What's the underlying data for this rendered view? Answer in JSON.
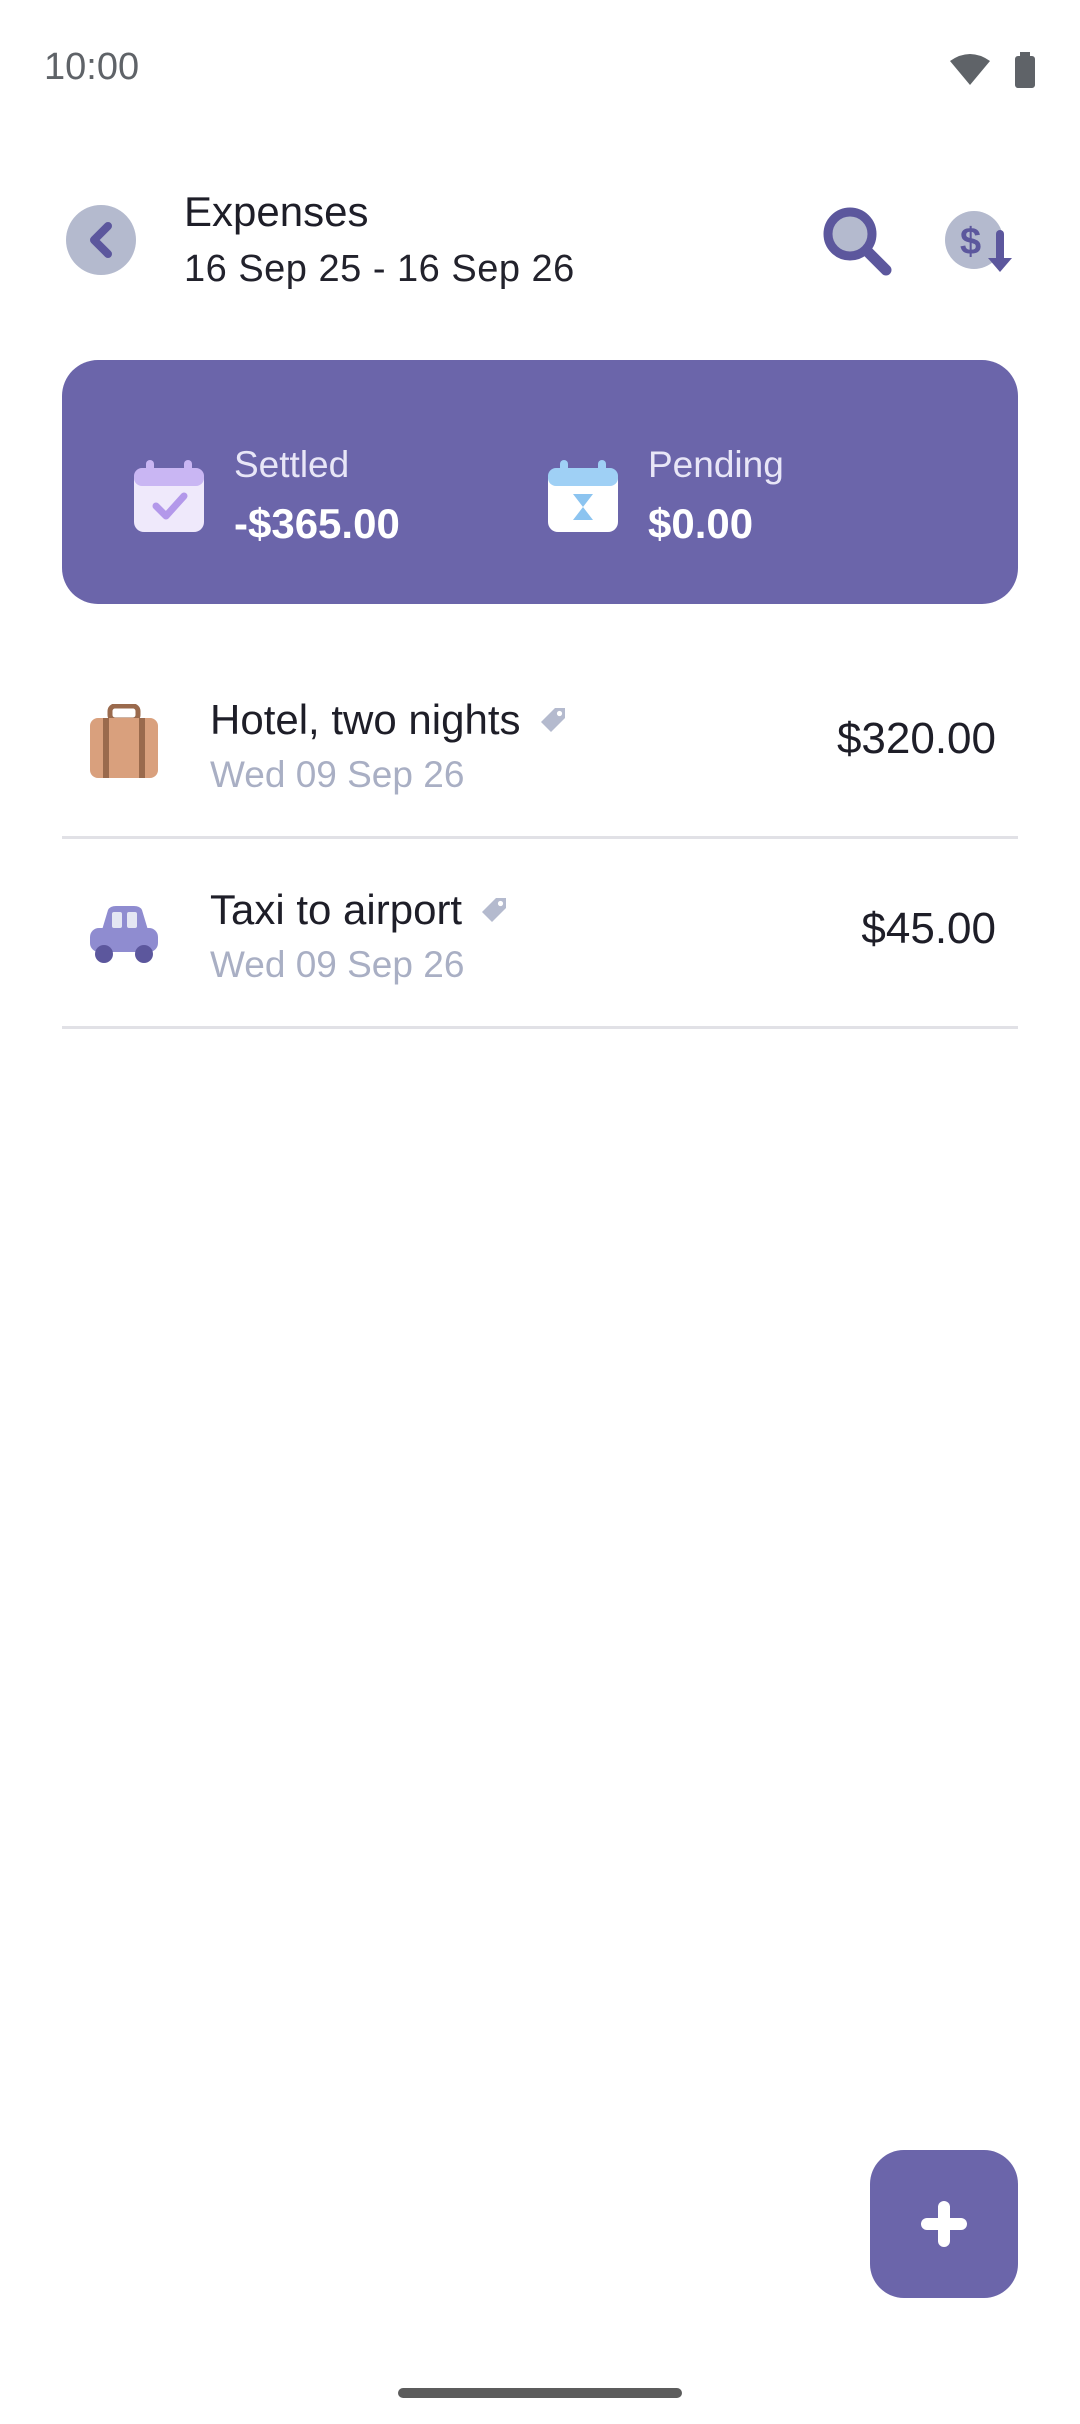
{
  "status_bar": {
    "time": "10:00"
  },
  "header": {
    "title": "Expenses",
    "subtitle": "16 Sep 25 - 16 Sep 26"
  },
  "summary": {
    "settled": {
      "label": "Settled",
      "value": "-$365.00"
    },
    "pending": {
      "label": "Pending",
      "value": "$0.00"
    }
  },
  "expenses": [
    {
      "name": "Hotel, two nights",
      "date": "Wed 09 Sep 26",
      "amount": "$320.00",
      "icon": "suitcase-icon"
    },
    {
      "name": "Taxi to airport",
      "date": "Wed 09 Sep 26",
      "amount": "$45.00",
      "icon": "car-icon"
    }
  ],
  "colors": {
    "accent": "#6b65aa",
    "muted_icon": "#b4bace",
    "date_text": "#a9afc4",
    "divider": "#e1e1e6"
  }
}
